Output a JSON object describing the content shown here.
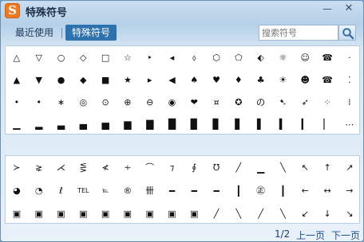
{
  "app": {
    "logo_glyph": "S",
    "title": "特殊符号",
    "minimize_glyph": "—",
    "close_glyph": "✕"
  },
  "tabs": [
    {
      "label": "最近使用",
      "active": false
    },
    {
      "label": "特殊符号",
      "active": true
    }
  ],
  "search": {
    "placeholder": "搜索符号"
  },
  "top_grid": [
    [
      "△",
      "▽",
      "○",
      "◇",
      "□",
      "☆",
      "‣",
      "◂",
      "⬨",
      "⬡",
      "⬠",
      "⬖",
      "☼",
      "☺",
      "☎",
      "·"
    ],
    [
      "▲",
      "▼",
      "●",
      "◆",
      "■",
      "★",
      "▸",
      "◀",
      "♠",
      "♥",
      "♦",
      "♣",
      "☀",
      "☻",
      "☎",
      "⁚"
    ],
    [
      "•",
      "•",
      "∗",
      "◎",
      "⊙",
      "⊕",
      "⊖",
      "◉",
      "❤",
      "¤",
      "✪",
      "の",
      "➷",
      "➶",
      "⁘",
      "⁞"
    ],
    [
      "▁",
      "▂",
      "▃",
      "▄",
      "▅",
      "▆",
      "▇",
      "█",
      "▉",
      "▊",
      "▋",
      "▌",
      "▍",
      "▎",
      "▏",
      "⋯"
    ]
  ],
  "bottom_grid": [
    [
      "≻",
      "⋧",
      "⋌",
      "⋚",
      "≮",
      "∻",
      "⌒",
      "⁊",
      "∮",
      "Ʊ",
      "╱",
      "▁",
      "╲",
      "↖",
      "↑",
      "↗"
    ],
    [
      "◕",
      "◔",
      "ℓ",
      "TEL",
      "℡",
      "®",
      "卌",
      "━",
      "━",
      "━",
      "┃",
      "㊣",
      "┃",
      "←",
      "↔",
      "→"
    ],
    [
      "▣",
      "▣",
      "▣",
      "▣",
      "▣",
      "▣",
      "▣",
      "▣",
      "▣",
      "╱",
      "╲",
      "╱",
      "╲",
      "↙",
      "↓",
      "↘"
    ]
  ],
  "footer": {
    "page": "1/2",
    "prev_label": "上一页",
    "next_label": "下一页"
  },
  "colors": {
    "accent": "#2e72ad",
    "logo": "#f07a21",
    "window_bg": "#dbe8f5",
    "panel_bg": "#ffffff"
  }
}
